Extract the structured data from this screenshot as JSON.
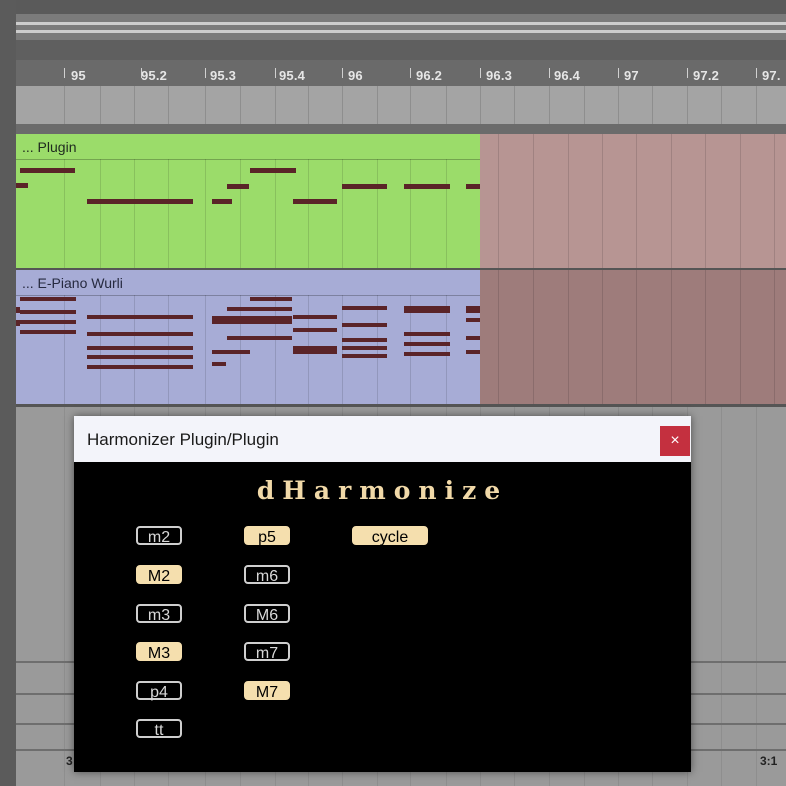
{
  "ruler": {
    "ticks": [
      "95",
      "95.2",
      "95.3",
      "95.4",
      "96",
      "96.2",
      "96.3",
      "96.4",
      "97",
      "97.2",
      "97."
    ]
  },
  "tracks": [
    {
      "title": "... Plugin",
      "color": "#9bdc6a"
    },
    {
      "title": "... E-Piano Wurli",
      "color": "#a7acd6"
    }
  ],
  "bottom": {
    "left_label": "3",
    "right_label": "3:1"
  },
  "plugin": {
    "window_title": "Harmonizer Plugin/Plugin",
    "close_label": "×",
    "name": "dHarmonize",
    "intervals": [
      {
        "label": "m2",
        "active": false
      },
      {
        "label": "M2",
        "active": true
      },
      {
        "label": "m3",
        "active": false
      },
      {
        "label": "M3",
        "active": true
      },
      {
        "label": "p4",
        "active": false
      },
      {
        "label": "tt",
        "active": false
      },
      {
        "label": "p5",
        "active": true
      },
      {
        "label": "m6",
        "active": false
      },
      {
        "label": "M6",
        "active": false
      },
      {
        "label": "m7",
        "active": false
      },
      {
        "label": "M7",
        "active": true
      },
      {
        "label": "cycle",
        "active": true
      }
    ],
    "accent_color": "#f5dfae"
  }
}
